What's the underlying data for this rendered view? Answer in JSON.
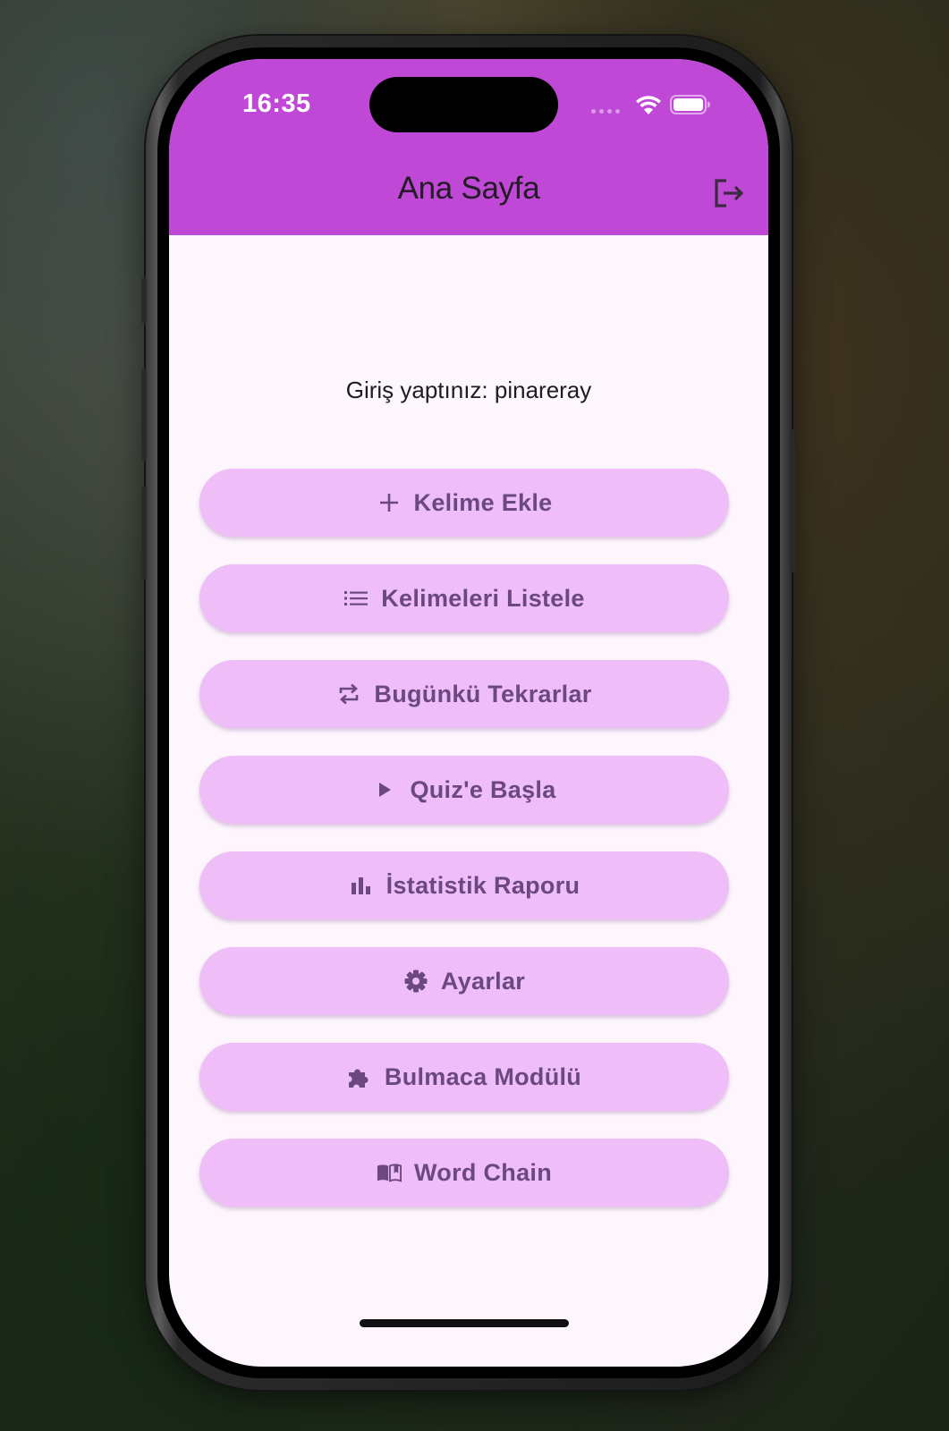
{
  "status_bar": {
    "time": "16:35",
    "icons": [
      "signal-dots-icon",
      "wifi-icon",
      "battery-icon"
    ]
  },
  "app_bar": {
    "title": "Ana Sayfa",
    "action_icon": "logout-icon",
    "background_color": "#bf48d6"
  },
  "main": {
    "welcome_text": "Giriş yaptınız: pinareray",
    "buttons": [
      {
        "label": "Kelime Ekle",
        "icon": "plus-icon"
      },
      {
        "label": "Kelimeleri Listele",
        "icon": "list-icon"
      },
      {
        "label": "Bugünkü Tekrarlar",
        "icon": "repeat-icon"
      },
      {
        "label": "Quiz'e Başla",
        "icon": "play-icon"
      },
      {
        "label": "İstatistik Raporu",
        "icon": "bar-chart-icon"
      },
      {
        "label": "Ayarlar",
        "icon": "gear-icon"
      },
      {
        "label": "Bulmaca Modülü",
        "icon": "puzzle-icon"
      },
      {
        "label": "Word Chain",
        "icon": "book-icon"
      }
    ],
    "button_color": "#efbef8",
    "button_text_color": "#6c4880"
  }
}
